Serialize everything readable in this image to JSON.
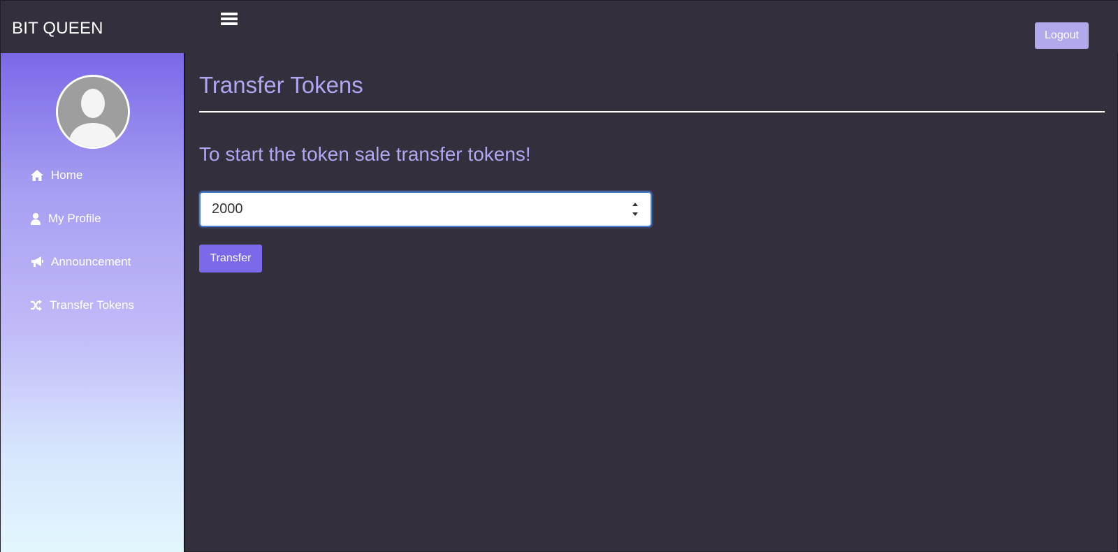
{
  "brand": {
    "name": "BIT QUEEN"
  },
  "header": {
    "logout_label": "Logout",
    "menu_icon": "hamburger-icon"
  },
  "sidebar": {
    "avatar_icon": "user-avatar-placeholder",
    "items": [
      {
        "label": "Home",
        "icon": "home-icon"
      },
      {
        "label": "My Profile",
        "icon": "user-icon"
      },
      {
        "label": "Announcement",
        "icon": "bullhorn-icon"
      },
      {
        "label": "Transfer Tokens",
        "icon": "shuffle-icon"
      }
    ]
  },
  "main": {
    "title": "Transfer Tokens",
    "subtitle": "To start the token sale transfer tokens!",
    "amount_value": "2000",
    "transfer_label": "Transfer"
  },
  "colors": {
    "background": "#332f3c",
    "accent": "#7a69e8",
    "title_text": "#b0a7f0",
    "logout_button": "#b2a9ec"
  }
}
